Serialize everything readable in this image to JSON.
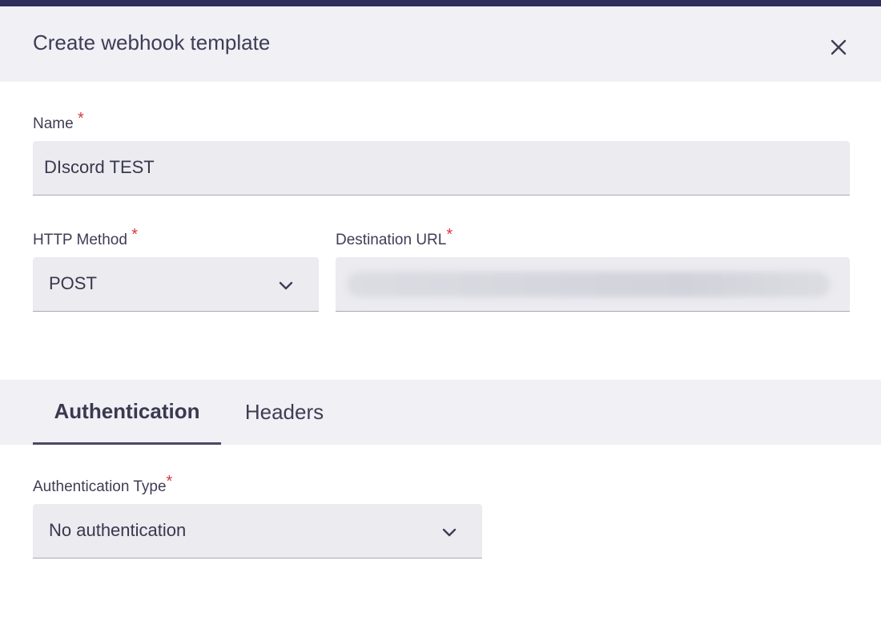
{
  "dialog": {
    "title": "Create webhook template"
  },
  "form": {
    "name": {
      "label": "Name",
      "required_mark": "*",
      "value": "DIscord TEST"
    },
    "http_method": {
      "label": "HTTP Method",
      "required_mark": "*",
      "value": "POST"
    },
    "destination_url": {
      "label": "Destination URL",
      "required_mark": "*",
      "value_state": "blurred"
    }
  },
  "tabs": [
    {
      "label": "Authentication",
      "active": true
    },
    {
      "label": "Headers",
      "active": false
    }
  ],
  "authentication": {
    "type": {
      "label": "Authentication Type",
      "required_mark": "*",
      "value": "No authentication"
    }
  },
  "icons": {
    "close": "close-icon",
    "chevron": "chevron-down-icon"
  },
  "colors": {
    "topbar": "#2e2d5c",
    "required": "#d9373e",
    "field_bg": "#ebebf0",
    "header_bg": "#f0f0f5"
  }
}
